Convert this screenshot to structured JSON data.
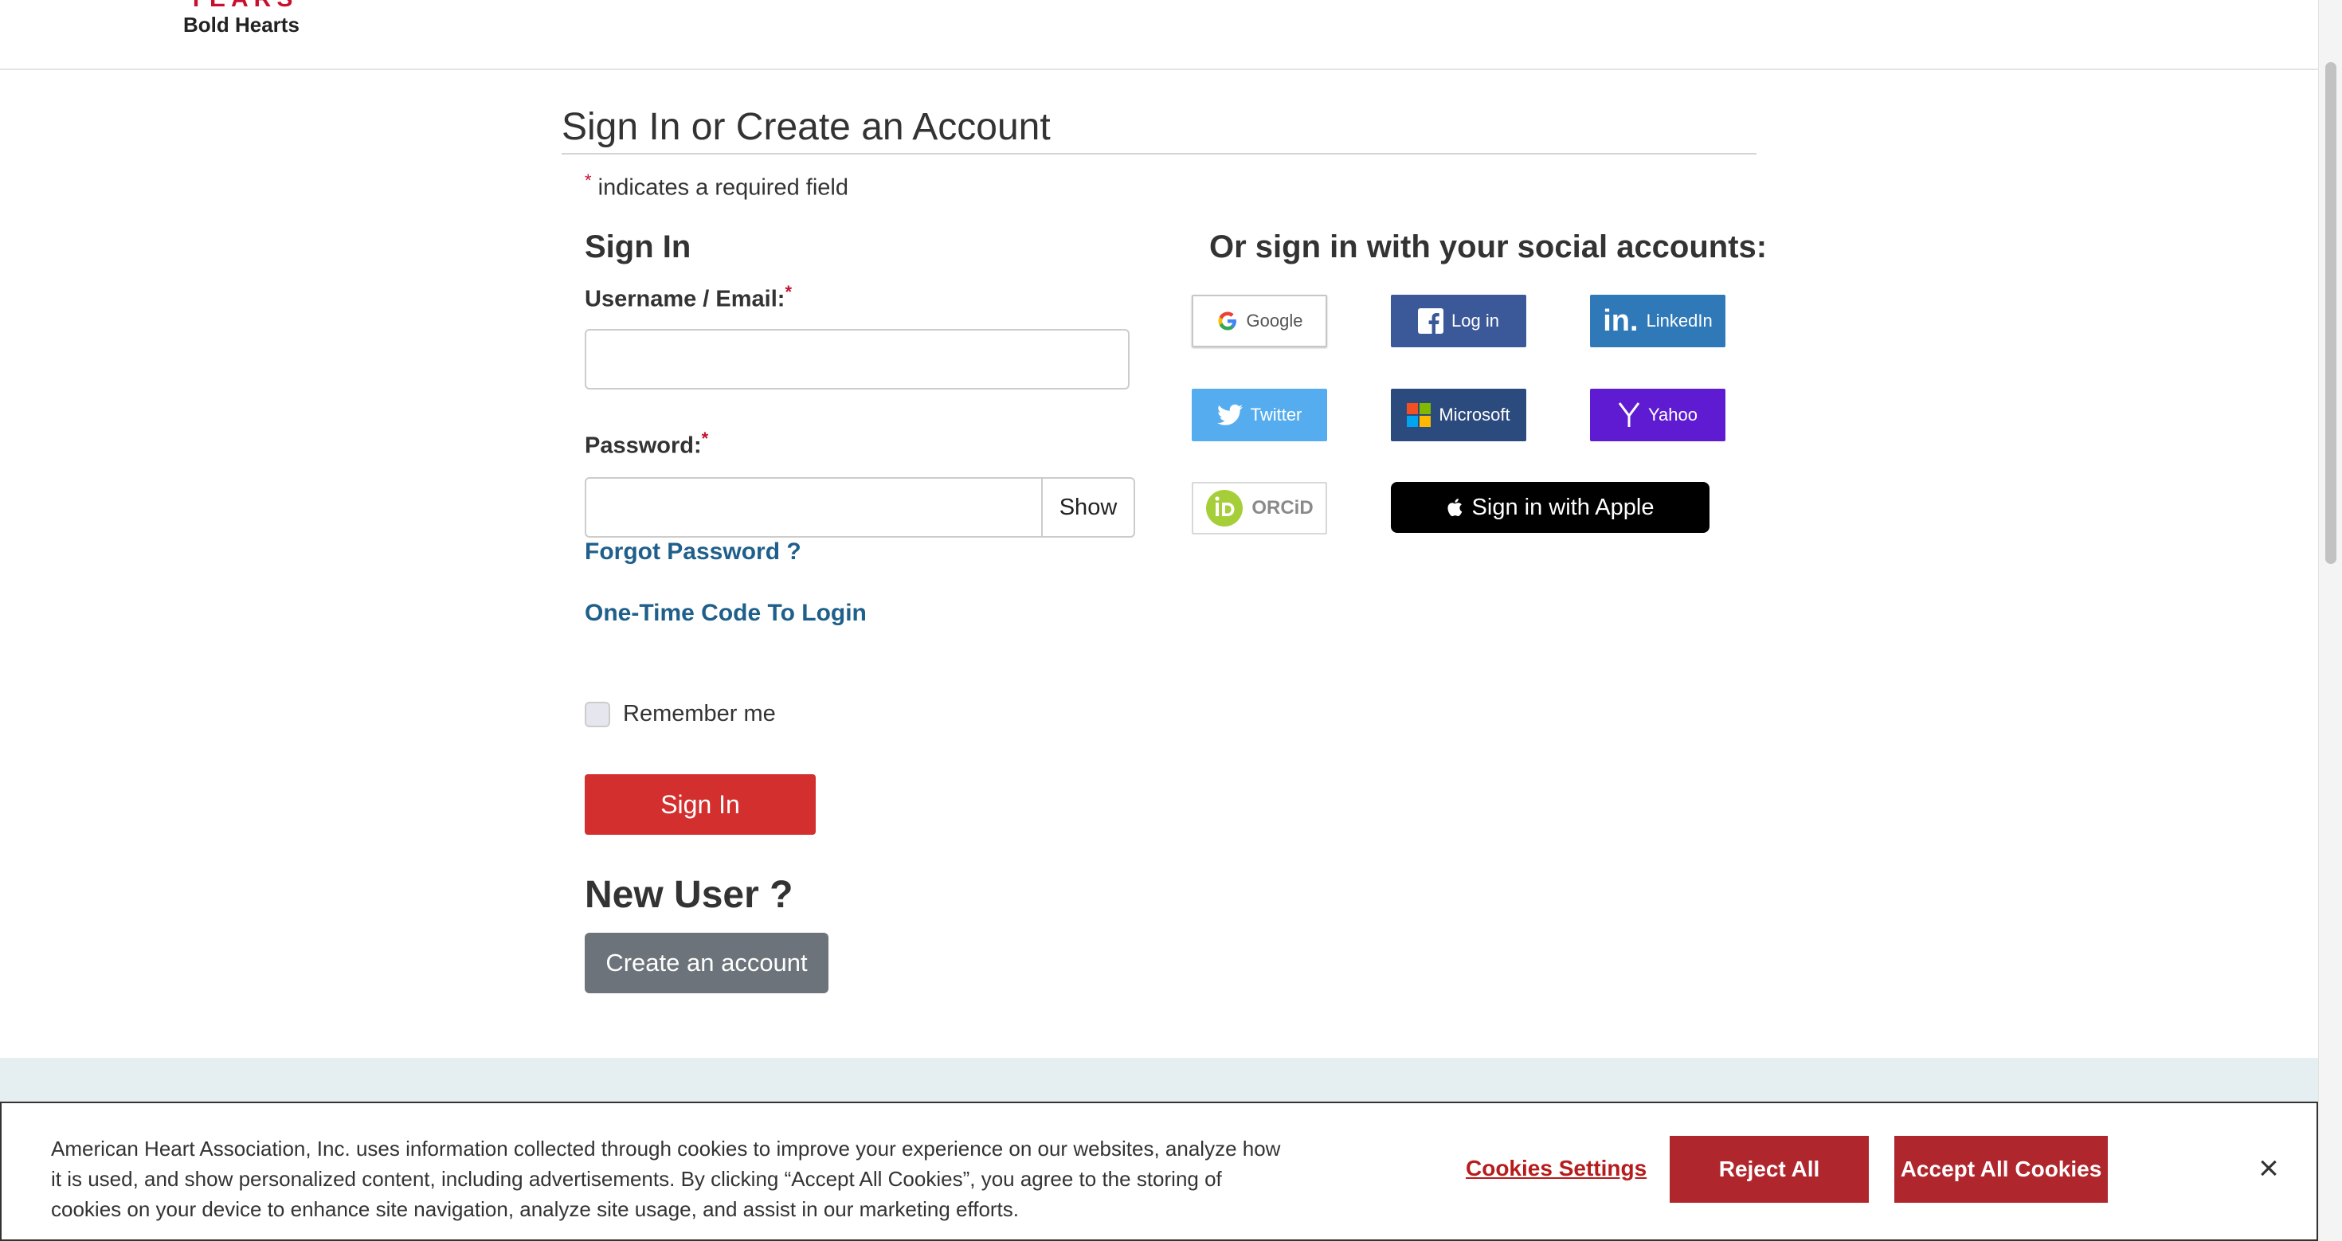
{
  "header": {
    "logo_years": "YEARS",
    "logo_sub": "Bold Hearts"
  },
  "page": {
    "title": "Sign In or Create an Account",
    "required_star": "*",
    "required_note": " indicates a required field"
  },
  "signin": {
    "heading": "Sign In",
    "username_label": "Username / Email:",
    "username_value": "",
    "password_label": "Password:",
    "password_value": "",
    "show_label": "Show",
    "forgot_password": "Forgot Password ?",
    "one_time_code": "One-Time Code To Login",
    "remember_me": "Remember me",
    "remember_checked": false,
    "submit_label": "Sign In"
  },
  "new_user": {
    "heading": "New User ?",
    "create_label": "Create an account"
  },
  "social": {
    "heading": "Or sign in with your social accounts:",
    "google": "Google",
    "facebook": "Log in",
    "linkedin": "LinkedIn",
    "twitter": "Twitter",
    "microsoft": "Microsoft",
    "yahoo": "Yahoo",
    "orcid": "ORCiD",
    "apple": "Sign in with Apple"
  },
  "cookie_banner": {
    "text": "American Heart Association, Inc. uses information collected through cookies to improve your experience on our websites, analyze how it is used, and show personalized content, including advertisements. By clicking “Accept All Cookies”, you agree to the storing of cookies on your device to enhance site navigation, analyze site usage, and assist in our marketing efforts.",
    "settings_label": "Cookies Settings",
    "reject_label": "Reject All",
    "accept_label": "Accept All Cookies",
    "close_symbol": "×"
  },
  "colors": {
    "brand_red": "#c8102e",
    "link_blue": "#1f5f8b",
    "signin_red": "#d32f2f",
    "cookie_red": "#b0262d",
    "create_gray": "#6c737a"
  }
}
